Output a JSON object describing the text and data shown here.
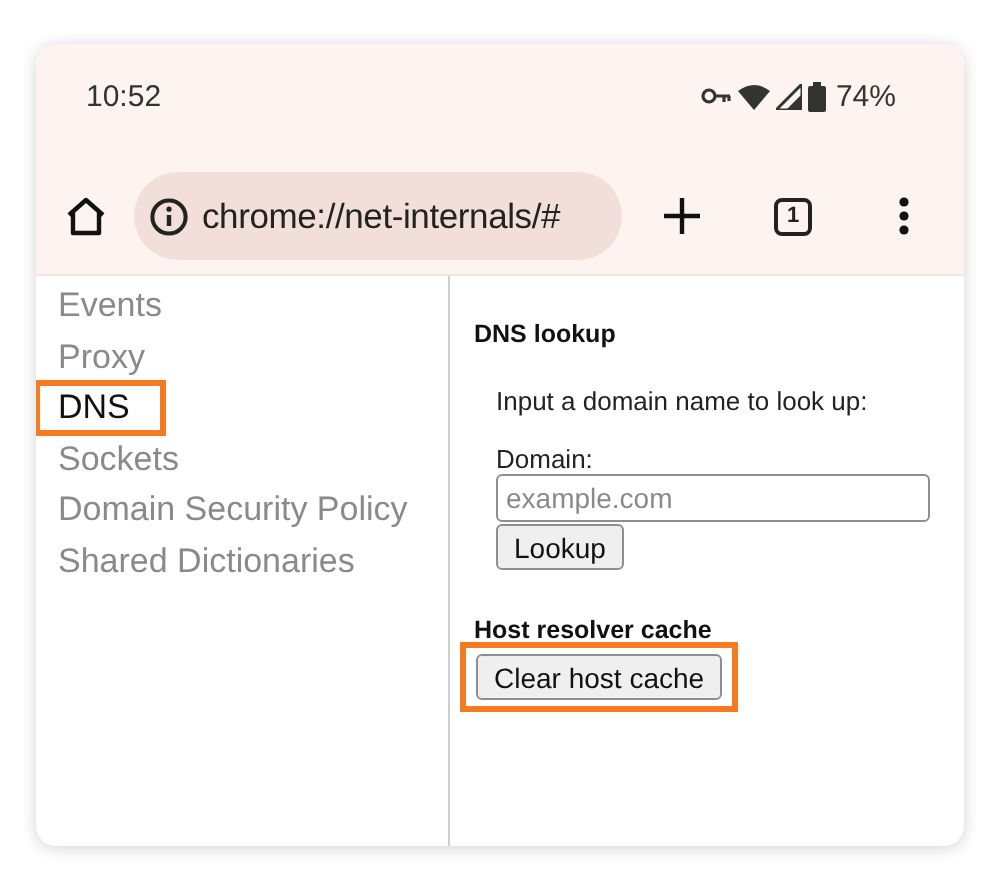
{
  "status_bar": {
    "time": "10:52",
    "battery_percent": "74%"
  },
  "toolbar": {
    "url": "chrome://net-internals/#",
    "tab_count": "1"
  },
  "sidebar": {
    "items": [
      {
        "label": "Events",
        "selected": false,
        "highlighted": false
      },
      {
        "label": "Proxy",
        "selected": false,
        "highlighted": false
      },
      {
        "label": "DNS",
        "selected": true,
        "highlighted": true
      },
      {
        "label": "Sockets",
        "selected": false,
        "highlighted": false
      },
      {
        "label": "Domain Security Policy",
        "selected": false,
        "highlighted": false
      },
      {
        "label": "Shared Dictionaries",
        "selected": false,
        "highlighted": false
      }
    ]
  },
  "dns_lookup": {
    "heading": "DNS lookup",
    "instruction": "Input a domain name to look up:",
    "field_label": "Domain:",
    "placeholder": "example.com",
    "button": "Lookup"
  },
  "host_resolver_cache": {
    "heading": "Host resolver cache",
    "button": {
      "label": "Clear host cache",
      "highlighted": true
    }
  }
}
